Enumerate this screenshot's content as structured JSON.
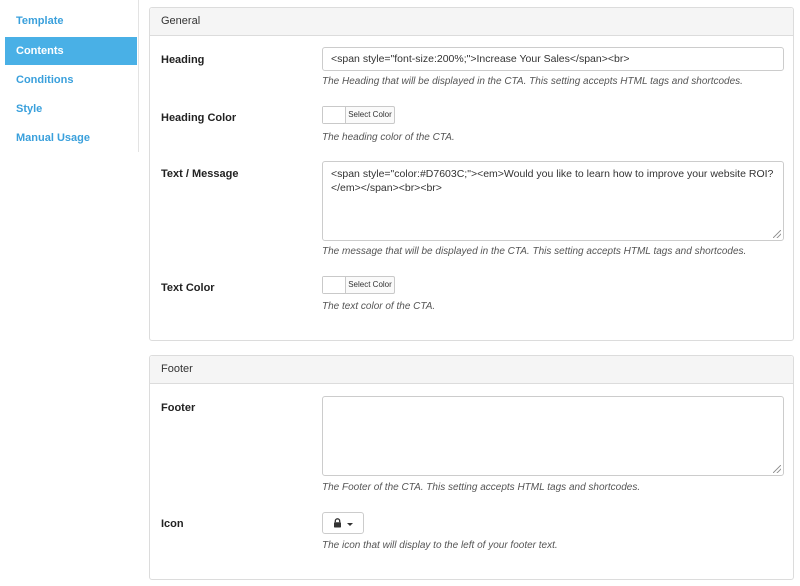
{
  "sidebar": {
    "items": [
      {
        "label": "Template"
      },
      {
        "label": "Contents",
        "active": true
      },
      {
        "label": "Conditions"
      },
      {
        "label": "Style"
      },
      {
        "label": "Manual Usage"
      }
    ]
  },
  "general": {
    "title": "General",
    "heading": {
      "label": "Heading",
      "value": "<span style=\"font-size:200%;\">Increase Your Sales</span><br>",
      "help": "The Heading that will be displayed in the CTA. This setting accepts HTML tags and shortcodes."
    },
    "heading_color": {
      "label": "Heading Color",
      "button": "Select Color",
      "help": "The heading color of the CTA."
    },
    "message": {
      "label": "Text / Message",
      "value": "<span style=\"color:#D7603C;\"><em>Would you like to learn how to improve your website ROI?</em></span><br><br>",
      "help": "The message that will be displayed in the CTA. This setting accepts HTML tags and shortcodes."
    },
    "text_color": {
      "label": "Text Color",
      "button": "Select Color",
      "help": "The text color of the CTA."
    }
  },
  "footer": {
    "title": "Footer",
    "footer_field": {
      "label": "Footer",
      "value": "",
      "help": "The Footer of the CTA. This setting accepts HTML tags and shortcodes."
    },
    "icon": {
      "label": "Icon",
      "icon_name": "lock-icon",
      "help": "The icon that will display to the left of your footer text."
    }
  },
  "colors": {
    "accent": "#49b0e6",
    "link": "#3aa0dc"
  }
}
